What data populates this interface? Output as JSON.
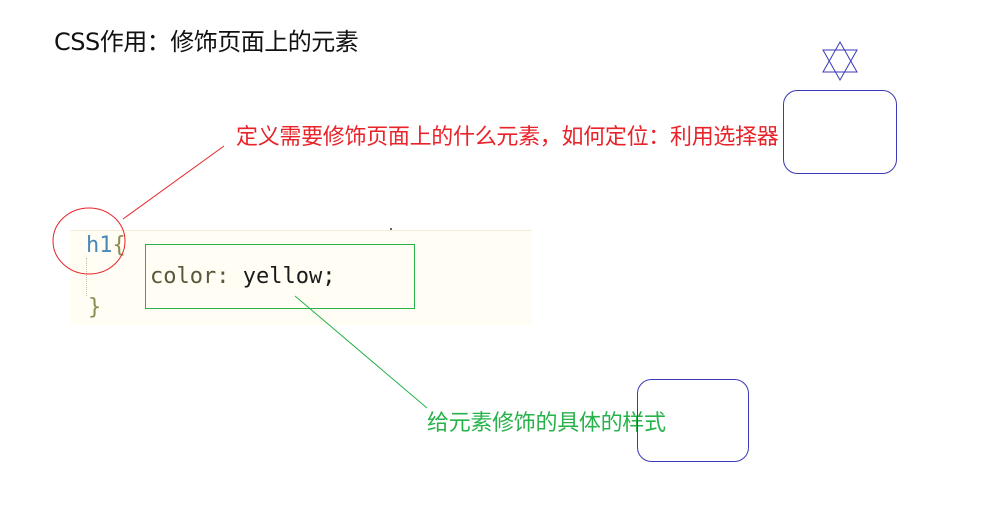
{
  "title": "CSS作用：修饰页面上的元素",
  "annotations": {
    "selector_note": "定义需要修饰页面上的什么元素，如何定位：利用选择器",
    "declaration_note": "给元素修饰的具体的样式"
  },
  "code": {
    "selector": "h1",
    "open_brace": "{",
    "property": "color",
    "colon": ":",
    "value": "yellow",
    "semicolon": ";",
    "close_brace": "}"
  },
  "colors": {
    "selector_highlight": "#e8232a",
    "declaration_highlight": "#27b24a",
    "note_frame": "#3a3ab8"
  },
  "icons": {
    "star": "six-point-star-icon"
  }
}
